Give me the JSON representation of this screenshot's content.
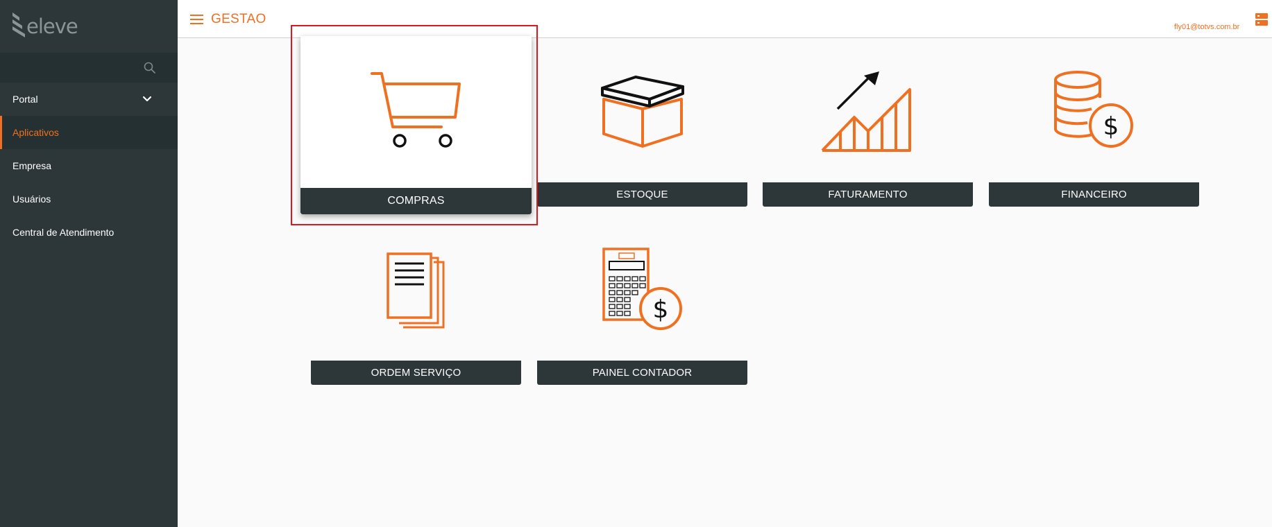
{
  "sidebar": {
    "logo_text": "eleve",
    "search": {
      "value": "",
      "placeholder": ""
    },
    "items": [
      {
        "label": "Portal"
      },
      {
        "label": "Aplicativos"
      },
      {
        "label": "Empresa"
      },
      {
        "label": "Usuários"
      },
      {
        "label": "Central de Atendimento"
      }
    ]
  },
  "header": {
    "title": "GESTAO",
    "user_email": "fly01@totvs.com.br"
  },
  "apps": [
    {
      "label": "COMPRAS",
      "icon": "shopping-cart-icon"
    },
    {
      "label": "ESTOQUE",
      "icon": "box-icon"
    },
    {
      "label": "FATURAMENTO",
      "icon": "growth-chart-icon"
    },
    {
      "label": "FINANCEIRO",
      "icon": "coins-dollar-icon"
    },
    {
      "label": "ORDEM SERVIÇO",
      "icon": "documents-icon"
    },
    {
      "label": "PAINEL CONTADOR",
      "icon": "calculator-dollar-icon"
    }
  ],
  "colors": {
    "accent": "#f07021",
    "sidebar": "#2d3638",
    "sidebar_dark": "#253032",
    "highlight": "#e2141c"
  }
}
